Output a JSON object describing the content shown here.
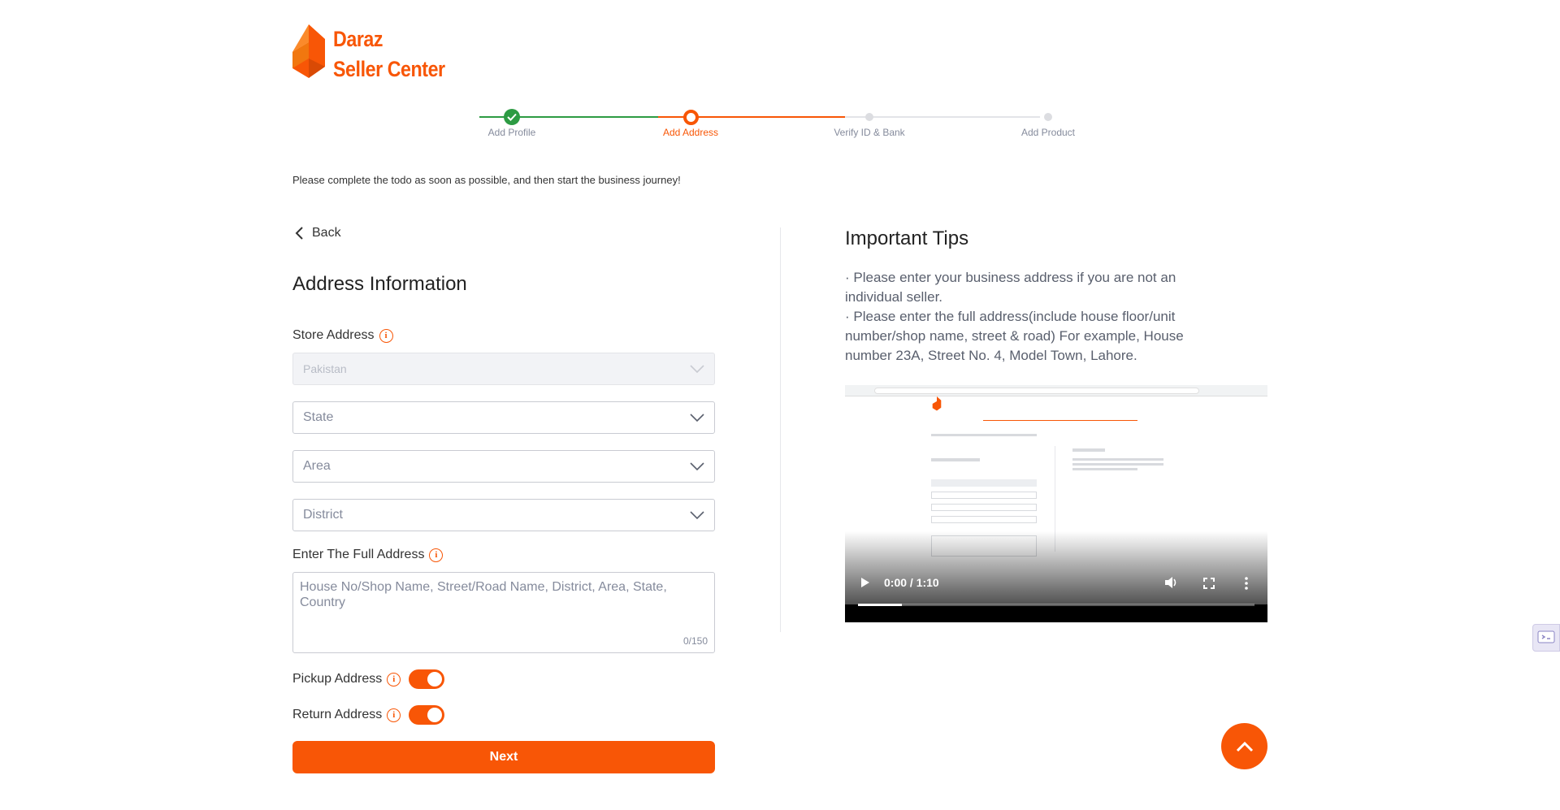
{
  "brand": {
    "line1": "Daraz",
    "line2": "Seller Center",
    "accent_color": "#f85606",
    "logo_icon": "daraz-logo-icon"
  },
  "stepper": {
    "steps": [
      {
        "label": "Add Profile",
        "state": "done"
      },
      {
        "label": "Add Address",
        "state": "active"
      },
      {
        "label": "Verify ID & Bank",
        "state": "pending"
      },
      {
        "label": "Add Product",
        "state": "pending"
      }
    ],
    "done_color": "#2d9b43"
  },
  "notice": "Please complete the todo as soon as possible, and then start the business journey!",
  "form": {
    "back_label": "Back",
    "title": "Address Information",
    "store_address_label": "Store Address",
    "country_value": "Pakistan",
    "state_placeholder": "State",
    "area_placeholder": "Area",
    "district_placeholder": "District",
    "full_address_label": "Enter The Full Address",
    "full_address_placeholder": "House No/Shop Name, Street/Road Name, District, Area, State, Country",
    "char_counter": "0/150",
    "pickup_label": "Pickup Address",
    "pickup_enabled": true,
    "return_label": "Return Address",
    "return_enabled": true,
    "next_label": "Next",
    "info_icon": "info-icon",
    "info_glyph": "i"
  },
  "tips": {
    "title": "Important Tips",
    "line1": "· Please enter your business address if you are not an individual seller.",
    "line2": "· Please enter the full address(include house floor/unit number/shop name, street & road) For example, House number 23A, Street No. 4, Model Town, Lahore."
  },
  "video": {
    "time": "0:00 / 1:10",
    "progress_fraction": 0.11
  }
}
